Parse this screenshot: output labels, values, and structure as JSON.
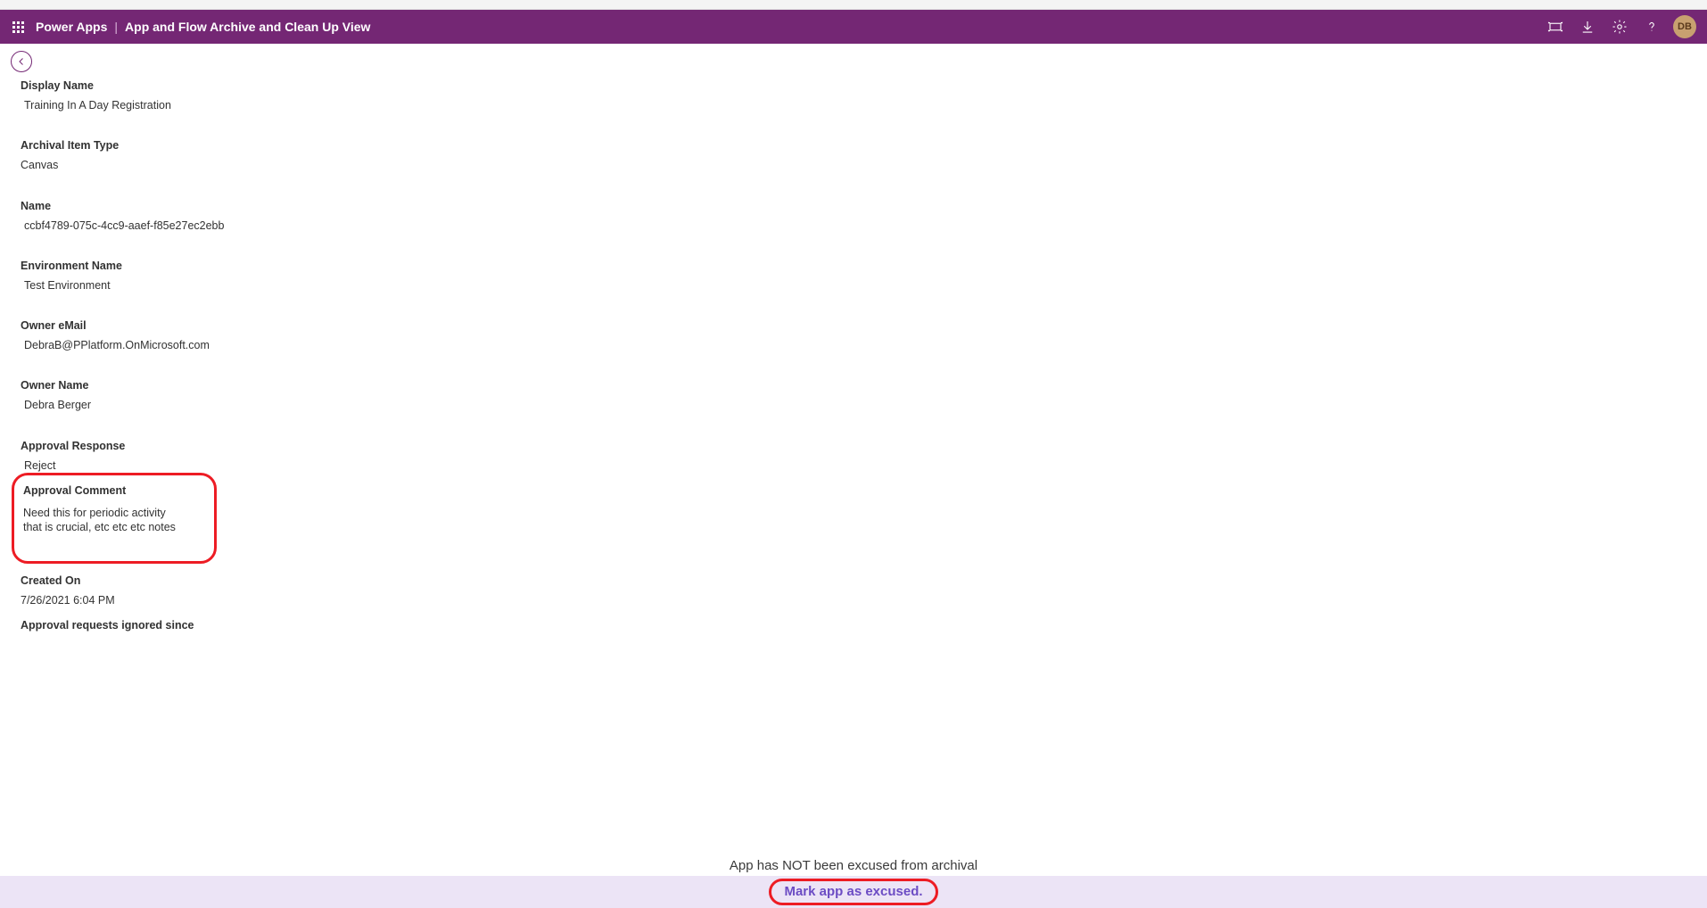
{
  "header": {
    "app": "Power Apps",
    "page": "App and Flow Archive and Clean Up View"
  },
  "fields": {
    "displayName": {
      "label": "Display Name",
      "value": "Training In A Day Registration"
    },
    "archivalItemType": {
      "label": "Archival Item Type",
      "value": "Canvas"
    },
    "name": {
      "label": "Name",
      "value": "ccbf4789-075c-4cc9-aaef-f85e27ec2ebb"
    },
    "environmentName": {
      "label": "Environment Name",
      "value": "Test Environment"
    },
    "ownerEmail": {
      "label": "Owner eMail",
      "value": "DebraB@PPlatform.OnMicrosoft.com"
    },
    "ownerName": {
      "label": "Owner Name",
      "value": "Debra Berger"
    },
    "approvalResponse": {
      "label": "Approval Response",
      "value": "Reject"
    },
    "approvalComment": {
      "label": "Approval Comment",
      "value": "Need this for periodic activity that is crucial, etc etc etc notes"
    },
    "createdOn": {
      "label": "Created On",
      "value": "7/26/2021 6:04 PM"
    },
    "approvalIgnored": {
      "label": "Approval requests ignored since",
      "value": ""
    }
  },
  "status": "App has NOT been excused from archival",
  "action": "Mark app as excused."
}
